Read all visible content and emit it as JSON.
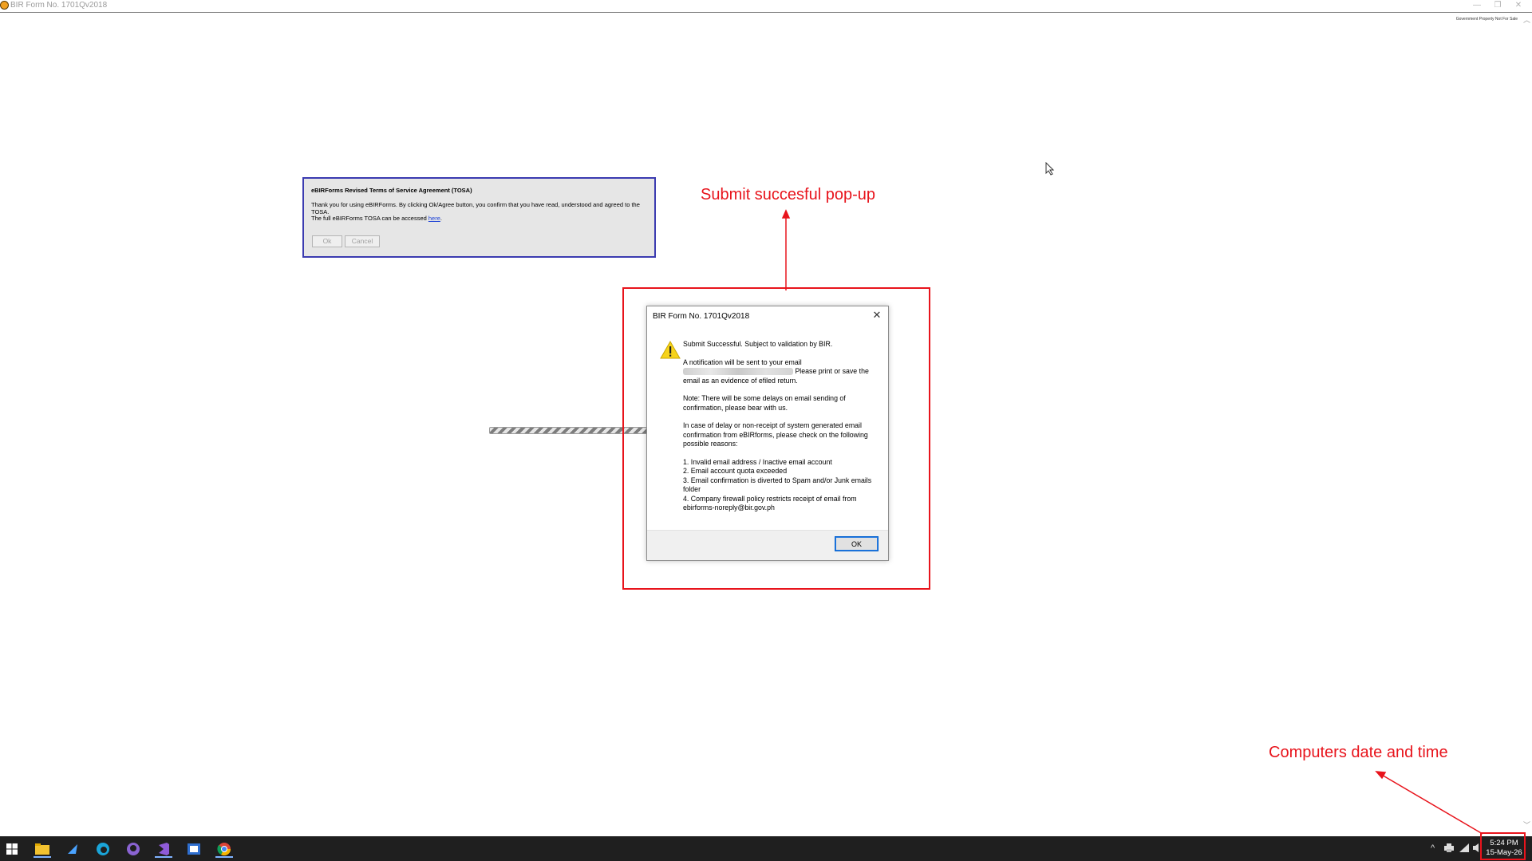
{
  "window": {
    "title": "BIR Form No. 1701Qv2018",
    "minimize_glyph": "—",
    "restore_glyph": "❐",
    "close_glyph": "✕",
    "watermark": "Government Property Not For Sale"
  },
  "tosa": {
    "title": "eBIRForms Revised Terms of Service Agreement (TOSA)",
    "text1": "Thank you for using eBIRForms. By clicking Ok/Agree button, you confirm that you have read, understood and agreed to the TOSA.",
    "text2_prefix": "The full eBIRForms TOSA can be accessed ",
    "link": "here",
    "text2_suffix": ".",
    "ok_label": "Ok",
    "cancel_label": "Cancel"
  },
  "annotations": {
    "popup_label": "Submit succesful pop-up",
    "clock_label": "Computers date and time",
    "color": "#e8141c"
  },
  "dialog": {
    "title": "BIR Form No. 1701Qv2018",
    "close_glyph": "✕",
    "icon": "warning-icon",
    "line1": "Submit Successful. Subject to validation by BIR.",
    "notif_prefix": "A notification will be sent to your email",
    "notif_suffix": " Please print or save the email as an evidence of efiled return.",
    "note": "Note: There will be some delays on email sending of confirmation, please bear with us.",
    "delay": "In case of delay or non-receipt of system generated email confirmation from eBIRforms, please check on the following possible reasons:",
    "reasons": [
      "1. Invalid email address / Inactive email account",
      "2. Email account quota exceeded",
      "3. Email confirmation is diverted to Spam and/or Junk emails folder",
      "4. Company firewall policy restricts receipt of email from ebirforms-noreply@bir.gov.ph"
    ],
    "ok_label": "OK"
  },
  "taskbar": {
    "icons": [
      "windows-start-icon",
      "file-explorer-icon",
      "app-icon",
      "edge-icon",
      "github-icon",
      "visual-studio-icon",
      "app-window-icon",
      "chrome-icon"
    ],
    "tray_chevron": "^",
    "time": "5:24 PM",
    "date": "15-May-26"
  }
}
